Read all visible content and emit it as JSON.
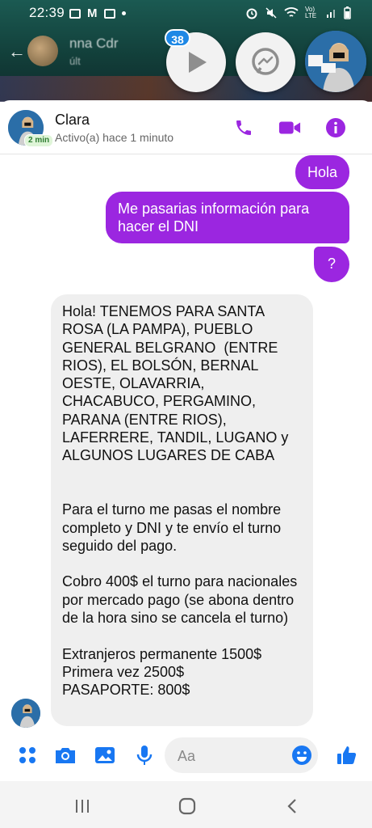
{
  "status_bar": {
    "time": "22:39",
    "network_label": "Vo) LTE"
  },
  "background_app": {
    "title_fragment": "nna Cdr",
    "subtitle_fragment": "últ"
  },
  "chat_heads": {
    "unread_count": "38"
  },
  "chat_header": {
    "contact_name": "Clara",
    "active_badge": "2 min",
    "status": "Activo(a) hace 1 minuto"
  },
  "messages": {
    "out_1": "Hola",
    "out_2": "Me pasarias información para hacer el DNI",
    "out_3": "?",
    "in_1": "Hola! TENEMOS PARA SANTA ROSA (LA PAMPA), PUEBLO GENERAL BELGRANO  (ENTRE RIOS), EL BOLSÓN, BERNAL OESTE, OLAVARRIA, CHACABUCO, PERGAMINO, PARANA (ENTRE RIOS), LAFERRERE, TANDIL, LUGANO y ALGUNOS LUGARES DE CABA\n\n\nPara el turno me pasas el nombre completo y DNI y te envío el turno seguido del pago.\n\nCobro 400$ el turno para nacionales por mercado pago (se abona dentro de la hora sino se cancela el turno)\n\nExtranjeros permanente 1500$\nPrimera vez 2500$\nPASAPORTE: 800$"
  },
  "composer": {
    "placeholder": "Aa"
  },
  "colors": {
    "accent": "#9b26e0",
    "incoming_bubble": "#efefef",
    "link_blue": "#1877f2"
  },
  "icons": {
    "header": [
      "phone-icon",
      "video-icon",
      "info-icon"
    ],
    "composer": [
      "apps-icon",
      "camera-icon",
      "gallery-icon",
      "mic-icon",
      "emoji-icon",
      "like-icon"
    ],
    "nav": [
      "recents-icon",
      "home-icon",
      "back-icon"
    ]
  }
}
